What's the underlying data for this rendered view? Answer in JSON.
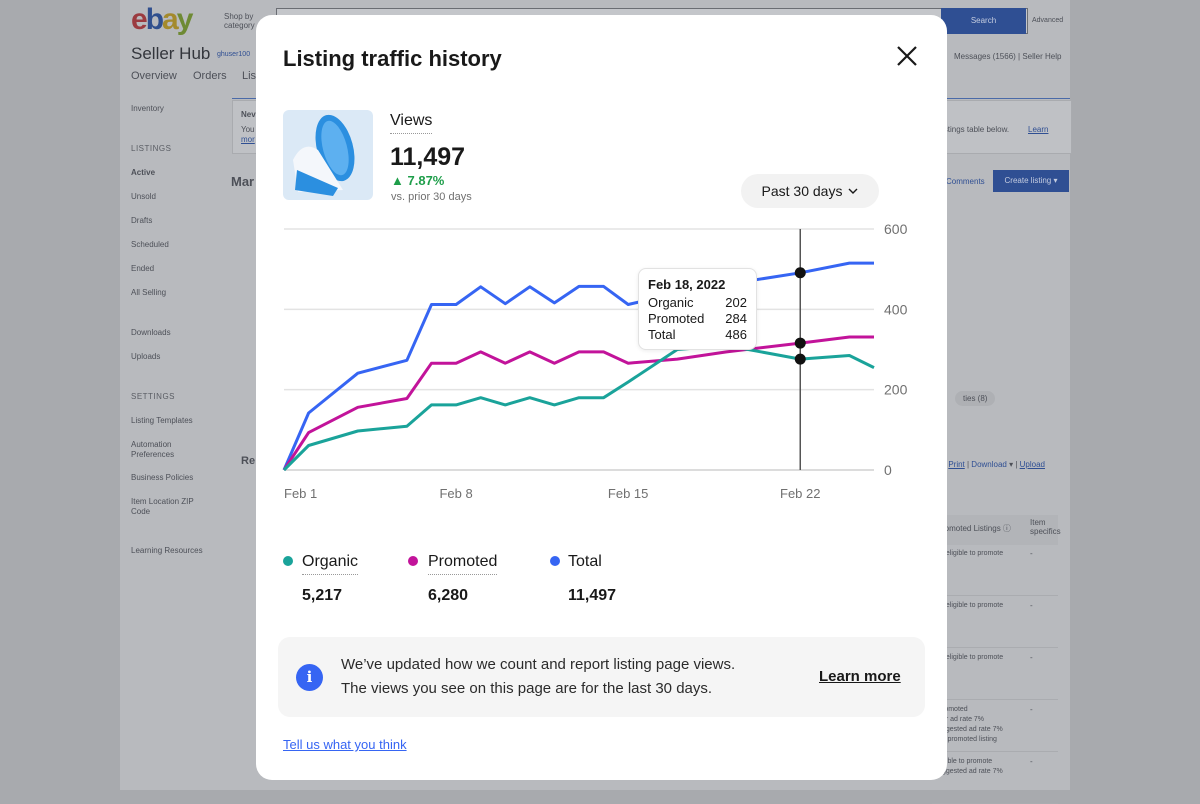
{
  "background": {
    "logo": [
      "e",
      "b",
      "a",
      "y"
    ],
    "shop_by_category": [
      "Shop by",
      "category"
    ],
    "search_button": "Search",
    "advanced_link": "Advanced",
    "seller_hub_title": "Seller Hub",
    "username": "ghuser100",
    "tabs": [
      "Overview",
      "Orders",
      "Lis"
    ],
    "header_links": "Messages (1566)  |  Seller Help",
    "left_nav": {
      "inventory": "Inventory",
      "listings_heading": "LISTINGS",
      "listings": [
        "Active",
        "Unsold",
        "Drafts",
        "Scheduled",
        "Ended",
        "All Selling"
      ],
      "downloads": "Downloads",
      "uploads": "Uploads",
      "settings_heading": "SETTINGS",
      "settings": [
        "Listing Templates",
        "Automation",
        "Preferences",
        "Business Policies",
        "Item Location ZIP",
        "Code"
      ],
      "learning": "Learning Resources"
    },
    "notice_fragments": [
      "Nev",
      "You",
      "mor"
    ],
    "notice_text": "istings table below.",
    "notice_link": "Learn",
    "section_fragments": [
      "Mar",
      "Re"
    ],
    "comments_link": "Comments",
    "create_listing": "Create listing",
    "filter_chip": "ties (8)",
    "table_actions": {
      "print": "Print",
      "download": "Download",
      "upload": "Upload"
    },
    "table_headers": [
      "romoted Listings",
      "Item specifics"
    ],
    "table_rows": [
      {
        "promo": "t eligible to promote",
        "item": "-"
      },
      {
        "promo": "t eligible to promote",
        "item": "-"
      },
      {
        "promo": "t eligible to promote",
        "item": "-"
      },
      {
        "promo": "romoted\nur ad rate 7%\nggested ad rate 7%\nit promoted listing",
        "item": "-"
      },
      {
        "promo": "gible to promote\nggested ad rate 7%",
        "item": "-"
      }
    ]
  },
  "modal": {
    "title": "Listing traffic history",
    "close_icon": "close-icon",
    "metric_label": "Views",
    "metric_value": "11,497",
    "change": "7.87%",
    "change_direction": "up",
    "change_color": "#1e9e4a",
    "comparison": "vs. prior 30 days",
    "range_select": "Past 30 days",
    "legend": [
      {
        "label": "Organic",
        "value": "5,217",
        "color": "#1aa39a"
      },
      {
        "label": "Promoted",
        "value": "6,280",
        "color": "#c2139a"
      },
      {
        "label": "Total",
        "value": "11,497",
        "color": "#3665f3"
      }
    ],
    "tooltip": {
      "date": "Feb 18, 2022",
      "rows": [
        {
          "label": "Organic",
          "value": "202"
        },
        {
          "label": "Promoted",
          "value": "284"
        },
        {
          "label": "Total",
          "value": "486"
        }
      ]
    },
    "info_banner": {
      "line1": "We’ve updated how we count and report listing page views.",
      "line2": "The views you see on this page are for the last 30 days.",
      "link": "Learn more"
    },
    "feedback_link": "Tell us what you think"
  },
  "chart_data": {
    "type": "line",
    "x": [
      "2022-02-01",
      "2022-02-02",
      "2022-02-04",
      "2022-02-06",
      "2022-02-07",
      "2022-02-08",
      "2022-02-09",
      "2022-02-10",
      "2022-02-11",
      "2022-02-12",
      "2022-02-13",
      "2022-02-14",
      "2022-02-15",
      "2022-02-17",
      "2022-02-19",
      "2022-02-22",
      "2022-02-24",
      "2022-02-25"
    ],
    "series": [
      {
        "name": "Total",
        "color": "#3665f3",
        "values": [
          0,
          142,
          241,
          273,
          412,
          412,
          456,
          414,
          456,
          416,
          457,
          457,
          412,
          440,
          462,
          491,
          515,
          515
        ]
      },
      {
        "name": "Promoted",
        "color": "#c2139a",
        "values": [
          0,
          93,
          156,
          178,
          266,
          266,
          294,
          266,
          294,
          266,
          294,
          294,
          266,
          276,
          294,
          316,
          331,
          331
        ]
      },
      {
        "name": "Organic",
        "color": "#1aa39a",
        "values": [
          0,
          61,
          97,
          109,
          162,
          162,
          180,
          162,
          180,
          162,
          180,
          180,
          219,
          300,
          310,
          276,
          285,
          255
        ]
      }
    ],
    "highlight_x": "2022-02-22",
    "x_ticks": [
      "Feb 1",
      "Feb 8",
      "Feb 15",
      "Feb 22"
    ],
    "x_tick_dates": [
      "2022-02-01",
      "2022-02-08",
      "2022-02-15",
      "2022-02-22"
    ],
    "y_ticks": [
      0,
      200,
      400,
      600
    ],
    "ylim": [
      0,
      600
    ],
    "y_axis_side": "right",
    "grid": true
  }
}
